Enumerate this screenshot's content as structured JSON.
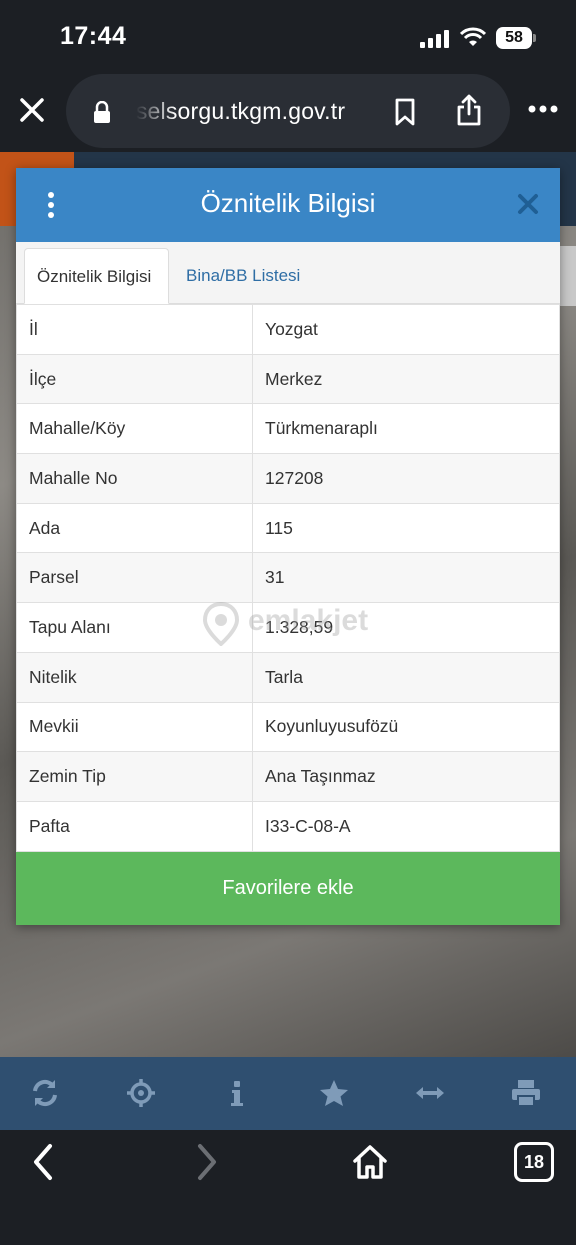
{
  "status_bar": {
    "time": "17:44",
    "battery": "58"
  },
  "browser": {
    "url": "parselsorgu.tkgm.gov.tr",
    "tab_count": "18"
  },
  "modal": {
    "title": "Öznitelik Bilgisi",
    "tabs": [
      {
        "label": "Öznitelik Bilgisi",
        "active": true
      },
      {
        "label": "Bina/BB Listesi",
        "active": false
      }
    ],
    "rows": [
      {
        "key": "İl",
        "value": "Yozgat"
      },
      {
        "key": "İlçe",
        "value": "Merkez"
      },
      {
        "key": "Mahalle/Köy",
        "value": "Türkmenaraplı"
      },
      {
        "key": "Mahalle No",
        "value": "127208"
      },
      {
        "key": "Ada",
        "value": "115"
      },
      {
        "key": "Parsel",
        "value": "31"
      },
      {
        "key": "Tapu Alanı",
        "value": "1.328,59"
      },
      {
        "key": "Nitelik",
        "value": "Tarla"
      },
      {
        "key": "Mevkii",
        "value": "Koyunluyusufözü"
      },
      {
        "key": "Zemin Tip",
        "value": "Ana Taşınmaz"
      },
      {
        "key": "Pafta",
        "value": "I33-C-08-A"
      }
    ],
    "favorite_button": "Favorilere ekle"
  },
  "watermark": "emlakjet",
  "map_toolbar": [
    "refresh-icon",
    "locate-icon",
    "info-icon",
    "star-icon",
    "measure-icon",
    "print-icon"
  ],
  "colors": {
    "header_blue": "#3a86c6",
    "button_green": "#5cb85c",
    "toolbar_blue": "#2f4f70",
    "link_blue": "#2f6ea5"
  }
}
